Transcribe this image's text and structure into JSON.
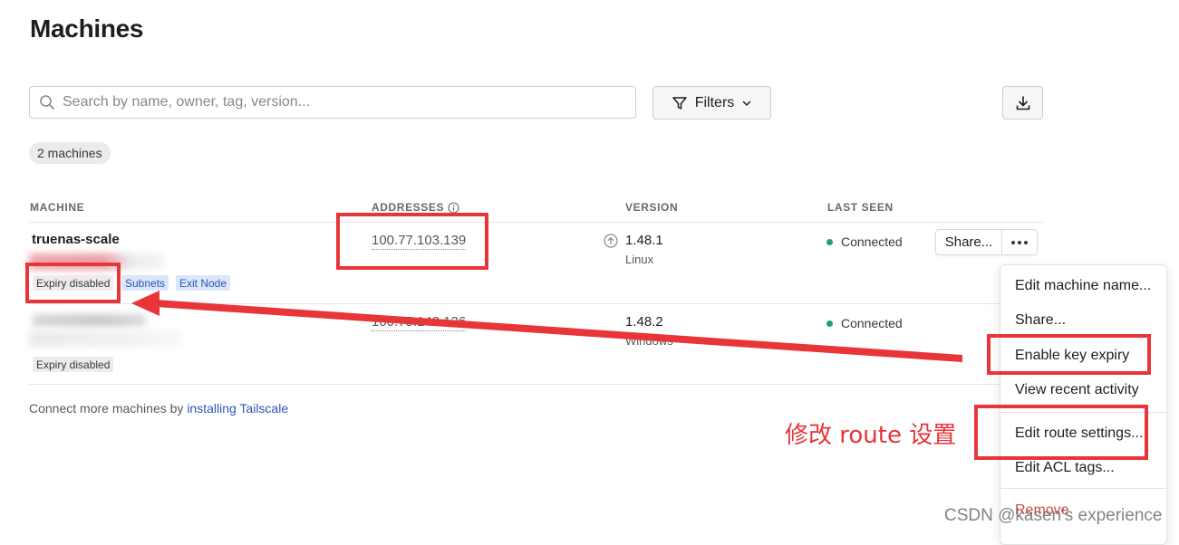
{
  "page": {
    "title": "Machines"
  },
  "toolbar": {
    "search_placeholder": "Search by name, owner, tag, version...",
    "filters_label": "Filters"
  },
  "summary": {
    "count_label": "2 machines"
  },
  "table": {
    "headers": {
      "machine": "MACHINE",
      "addresses": "ADDRESSES",
      "version": "VERSION",
      "last_seen": "LAST SEEN"
    },
    "rows": [
      {
        "name": "truenas-scale",
        "tags": [
          "Expiry disabled",
          "Subnets",
          "Exit Node"
        ],
        "address": "100.77.103.139",
        "version": "1.48.1",
        "os": "Linux",
        "status": "Connected",
        "share_label": "Share..."
      },
      {
        "name": "",
        "tags": [
          "Expiry disabled"
        ],
        "address": "100.75.143.136",
        "version": "1.48.2",
        "os": "Windows",
        "status": "Connected"
      }
    ]
  },
  "footer": {
    "text": "Connect more machines by ",
    "link": "installing Tailscale"
  },
  "context_menu": {
    "items": [
      "Edit machine name...",
      "Share...",
      "Enable key expiry",
      "View recent activity",
      "Edit route settings...",
      "Edit ACL tags...",
      "Remove"
    ]
  },
  "annotation": {
    "label": "修改 route 设置",
    "color": "#e8353a"
  },
  "watermark": "CSDN @kasen's experience",
  "colors": {
    "connected": "#1aa36a",
    "danger": "#d84a3c",
    "link": "#2d55b8",
    "annotation": "#e8353a"
  }
}
